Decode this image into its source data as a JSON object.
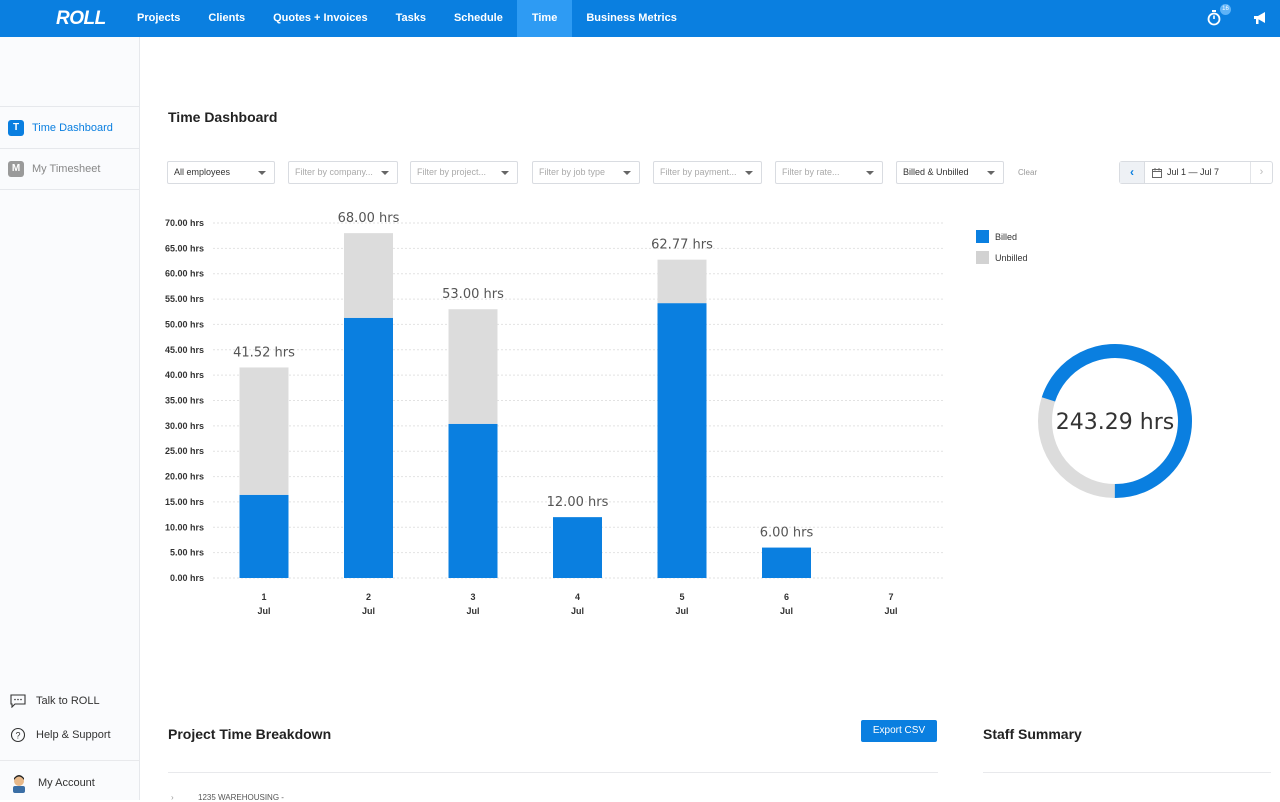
{
  "topnav": {
    "logo": "ROLL",
    "items": [
      {
        "label": "Projects"
      },
      {
        "label": "Clients"
      },
      {
        "label": "Quotes + Invoices"
      },
      {
        "label": "Tasks"
      },
      {
        "label": "Schedule"
      },
      {
        "label": "Time",
        "active": true
      },
      {
        "label": "Business Metrics"
      }
    ],
    "timer_badge": "16",
    "icons": [
      "timer-icon",
      "megaphone-icon"
    ]
  },
  "sidebar": {
    "items": [
      {
        "letter": "T",
        "label": "Time Dashboard",
        "active": true
      },
      {
        "letter": "M",
        "label": "My Timesheet",
        "active": false
      }
    ],
    "bottom": {
      "talk": "Talk to ROLL",
      "help": "Help & Support",
      "account": "My Account"
    }
  },
  "main": {
    "title": "Time Dashboard",
    "filters": [
      {
        "value": "All employees",
        "placeholder": false
      },
      {
        "value": "Filter by company...",
        "placeholder": true
      },
      {
        "value": "Filter by project...",
        "placeholder": true
      },
      {
        "value": "Filter by job type",
        "placeholder": true
      },
      {
        "value": "Filter by payment...",
        "placeholder": true
      },
      {
        "value": "Filter by rate...",
        "placeholder": true
      },
      {
        "value": "Billed & Unbilled",
        "placeholder": false
      }
    ],
    "clear_label": "Clear",
    "date_range": "Jul 1 — Jul 7",
    "legend": {
      "billed": "Billed",
      "unbilled": "Unbilled"
    },
    "donut_total": "243.29 hrs",
    "project_section": {
      "title": "Project Time Breakdown",
      "export_label": "Export CSV",
      "first_row": "1235 WAREHOUSING -"
    },
    "staff_section": {
      "title": "Staff Summary"
    }
  },
  "colors": {
    "accent": "#0a7fe0",
    "unbilled": "#dcdcdc",
    "nav_active": "#2e9bf3"
  },
  "chart_data": {
    "type": "bar",
    "stacked": true,
    "categories": [
      "1 Jul",
      "2 Jul",
      "3 Jul",
      "4 Jul",
      "5 Jul",
      "6 Jul",
      "7 Jul"
    ],
    "x_day": [
      "1",
      "2",
      "3",
      "4",
      "5",
      "6",
      "7"
    ],
    "x_month": "Jul",
    "series": [
      {
        "name": "Billed",
        "color": "#0a7fe0",
        "values": [
          16.4,
          51.3,
          30.4,
          12.0,
          54.2,
          6.0,
          0
        ]
      },
      {
        "name": "Unbilled",
        "color": "#dcdcdc",
        "values": [
          25.12,
          16.7,
          22.6,
          0,
          8.57,
          0,
          0
        ]
      }
    ],
    "totals_labels": [
      "41.52 hrs",
      "68.00 hrs",
      "53.00 hrs",
      "12.00 hrs",
      "62.77 hrs",
      "6.00 hrs",
      ""
    ],
    "totals": [
      41.52,
      68.0,
      53.0,
      12.0,
      62.77,
      6.0,
      0
    ],
    "ylim": [
      0,
      70
    ],
    "yticks": [
      0,
      5,
      10,
      15,
      20,
      25,
      30,
      35,
      40,
      45,
      50,
      55,
      60,
      65,
      70
    ],
    "ytick_suffix": " hrs",
    "grid": true,
    "legend_position": "right",
    "donut": {
      "total": 243.29,
      "billed_fraction": 0.7,
      "unbilled_fraction": 0.3
    }
  }
}
